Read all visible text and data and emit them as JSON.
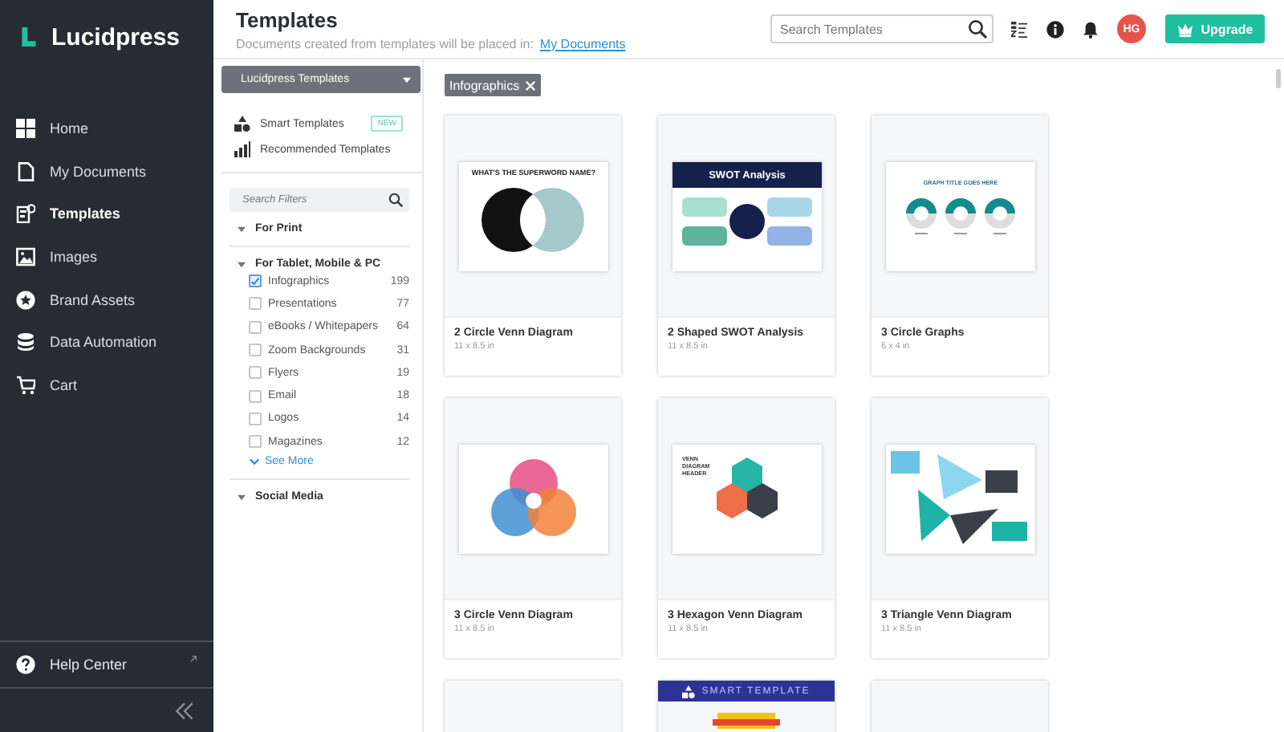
{
  "sidebar": {
    "logo": "Lucidpress",
    "items": [
      {
        "label": "Home",
        "selected": false
      },
      {
        "label": "My Documents",
        "selected": false
      },
      {
        "label": "Templates",
        "selected": true
      },
      {
        "label": "Images",
        "selected": false
      },
      {
        "label": "Brand Assets",
        "selected": false
      },
      {
        "label": "Data Automation",
        "selected": false
      },
      {
        "label": "Cart",
        "selected": false
      }
    ],
    "help": "Help Center"
  },
  "header": {
    "title": "Templates",
    "subtitle": "Documents created from templates will be placed in:",
    "link": "My Documents",
    "search": {
      "placeholder": "Search Templates"
    },
    "avatar": "HG",
    "upgrade": "Upgrade"
  },
  "filters": {
    "source": "Lucidpress Templates",
    "links": [
      {
        "label": "Smart Templates",
        "badge": "NEW"
      },
      {
        "label": "Recommended Templates"
      }
    ],
    "search": {
      "placeholder": "Search Filters"
    },
    "sections": [
      {
        "label": "For Print"
      },
      {
        "label": "For Tablet, Mobile & PC",
        "items": [
          {
            "label": "Infographics",
            "count": "199",
            "checked": true
          },
          {
            "label": "Presentations",
            "count": "77",
            "checked": false
          },
          {
            "label": "eBooks / Whitepapers",
            "count": "64",
            "checked": false
          },
          {
            "label": "Zoom Backgrounds",
            "count": "31",
            "checked": false
          },
          {
            "label": "Flyers",
            "count": "19",
            "checked": false
          },
          {
            "label": "Email",
            "count": "18",
            "checked": false
          },
          {
            "label": "Logos",
            "count": "14",
            "checked": false
          },
          {
            "label": "Magazines",
            "count": "12",
            "checked": false
          }
        ],
        "see_more": "See More"
      },
      {
        "label": "Social Media"
      }
    ]
  },
  "active_filters": [
    {
      "label": "Infographics"
    }
  ],
  "templates": [
    {
      "kind": "venn2",
      "name": "2 Circle Venn Diagram",
      "size": "11 x 8.5 in",
      "preview_title": "WHAT'S THE SUPERWORD NAME?"
    },
    {
      "kind": "swot",
      "name": "2 Shaped SWOT Analysis",
      "size": "11 x 8.5 in",
      "preview_title": "SWOT Analysis"
    },
    {
      "kind": "graphs",
      "name": "3 Circle Graphs",
      "size": "6 x 4 in",
      "preview_title": "GRAPH TITLE GOES HERE"
    },
    {
      "kind": "venn3",
      "name": "3 Circle Venn Diagram",
      "size": "11 x 8.5 in"
    },
    {
      "kind": "hexagon",
      "name": "3 Hexagon Venn Diagram",
      "size": "11 x 8.5 in",
      "preview_title": "VENN DIAGRAM HEADER"
    },
    {
      "kind": "triangle",
      "name": "3 Triangle Venn Diagram",
      "size": "11 x 8.5 in"
    },
    {
      "kind": "blank"
    },
    {
      "kind": "smart",
      "banner": "SMART TEMPLATE"
    },
    {
      "kind": "blank"
    }
  ]
}
